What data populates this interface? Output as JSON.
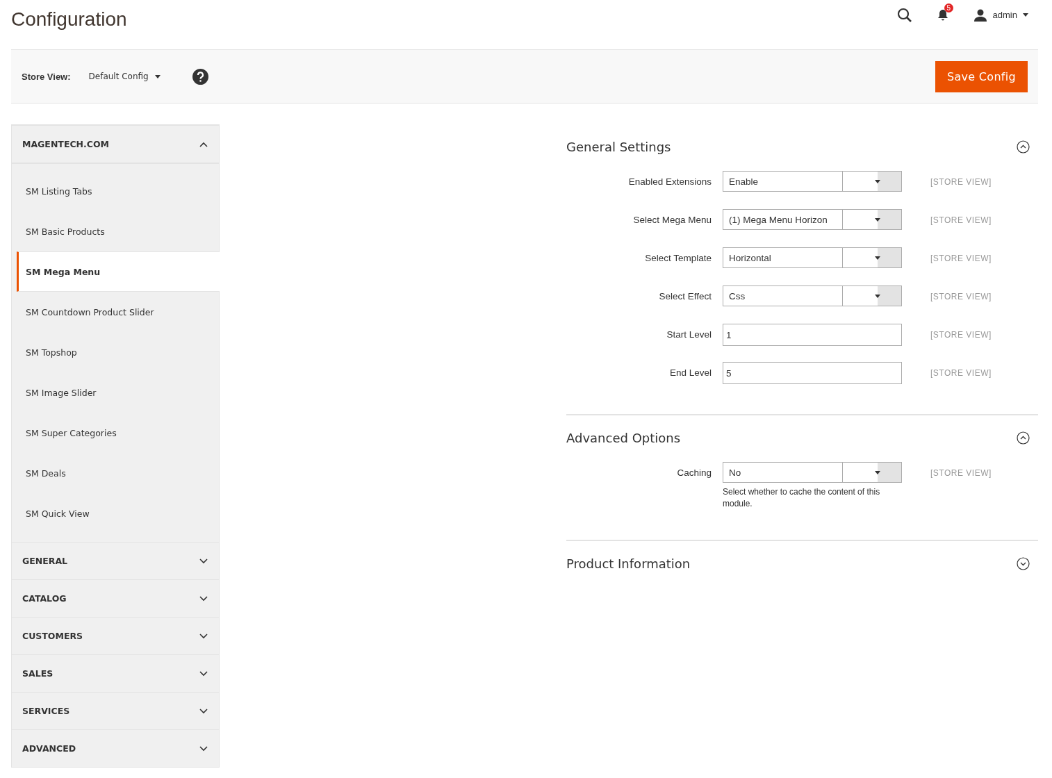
{
  "page_title": "Configuration",
  "header": {
    "notification_count": "5",
    "user": "admin"
  },
  "toolbar": {
    "store_view_label": "Store View:",
    "store_view_value": "Default Config",
    "save_button": "Save Config"
  },
  "sidebar": [
    {
      "title": "MAGENTECH.COM",
      "expanded": true,
      "items": [
        {
          "label": "SM Listing Tabs",
          "selected": false
        },
        {
          "label": "SM Basic Products",
          "selected": false
        },
        {
          "label": "SM Mega Menu",
          "selected": true
        },
        {
          "label": "SM Countdown Product Slider",
          "selected": false
        },
        {
          "label": "SM Topshop",
          "selected": false
        },
        {
          "label": "SM Image Slider",
          "selected": false
        },
        {
          "label": "SM Super Categories",
          "selected": false
        },
        {
          "label": "SM Deals",
          "selected": false
        },
        {
          "label": "SM Quick View",
          "selected": false
        }
      ]
    },
    {
      "title": "GENERAL",
      "expanded": false
    },
    {
      "title": "CATALOG",
      "expanded": false
    },
    {
      "title": "CUSTOMERS",
      "expanded": false
    },
    {
      "title": "SALES",
      "expanded": false
    },
    {
      "title": "SERVICES",
      "expanded": false
    },
    {
      "title": "ADVANCED",
      "expanded": false
    }
  ],
  "sections": [
    {
      "title": "General Settings",
      "expanded": true,
      "fields": [
        {
          "label": "Enabled Extensions",
          "kind": "select",
          "value": "Enable",
          "scope": "[STORE VIEW]"
        },
        {
          "label": "Select Mega Menu",
          "kind": "select",
          "value": "(1) Mega Menu Horizon",
          "scope": "[STORE VIEW]"
        },
        {
          "label": "Select Template",
          "kind": "select",
          "value": "Horizontal",
          "scope": "[STORE VIEW]"
        },
        {
          "label": "Select Effect",
          "kind": "select",
          "value": "Css",
          "scope": "[STORE VIEW]"
        },
        {
          "label": "Start Level",
          "kind": "text",
          "value": "1",
          "scope": "[STORE VIEW]"
        },
        {
          "label": "End Level",
          "kind": "text",
          "value": "5",
          "scope": "[STORE VIEW]"
        }
      ]
    },
    {
      "title": "Advanced Options",
      "expanded": true,
      "fields": [
        {
          "label": "Caching",
          "kind": "select",
          "value": "No",
          "scope": "[STORE VIEW]",
          "note": "Select whether to cache the content of this module."
        }
      ]
    },
    {
      "title": "Product Information",
      "expanded": false
    }
  ]
}
